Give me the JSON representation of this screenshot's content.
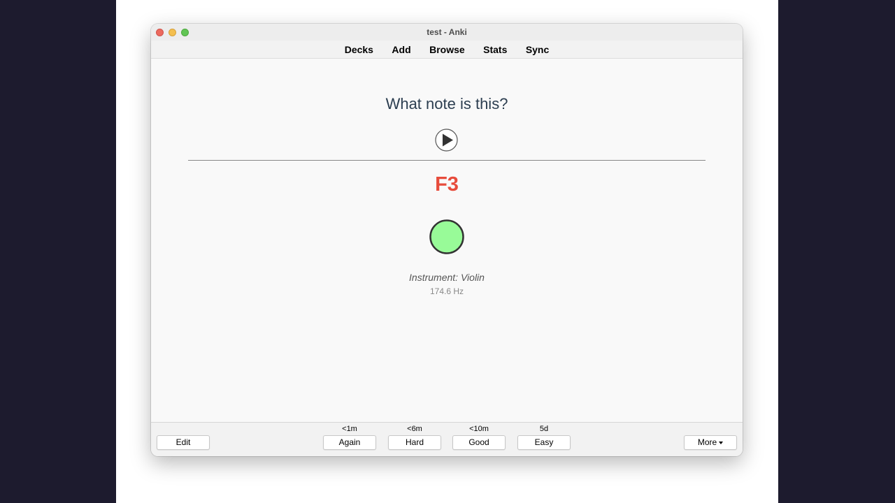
{
  "window": {
    "title": "test - Anki"
  },
  "toolbar": {
    "items": [
      "Decks",
      "Add",
      "Browse",
      "Stats",
      "Sync"
    ]
  },
  "card": {
    "question": "What note is this?",
    "answer": "F3",
    "instrument": "Instrument: Violin",
    "frequency": "174.6 Hz",
    "note_circle_color": "#98fb98",
    "answer_color": "#e74c3c"
  },
  "bottom": {
    "edit_label": "Edit",
    "more_label": "More",
    "ease": [
      {
        "time": "<1m",
        "label": "Again"
      },
      {
        "time": "<6m",
        "label": "Hard"
      },
      {
        "time": "<10m",
        "label": "Good"
      },
      {
        "time": "5d",
        "label": "Easy"
      }
    ]
  }
}
